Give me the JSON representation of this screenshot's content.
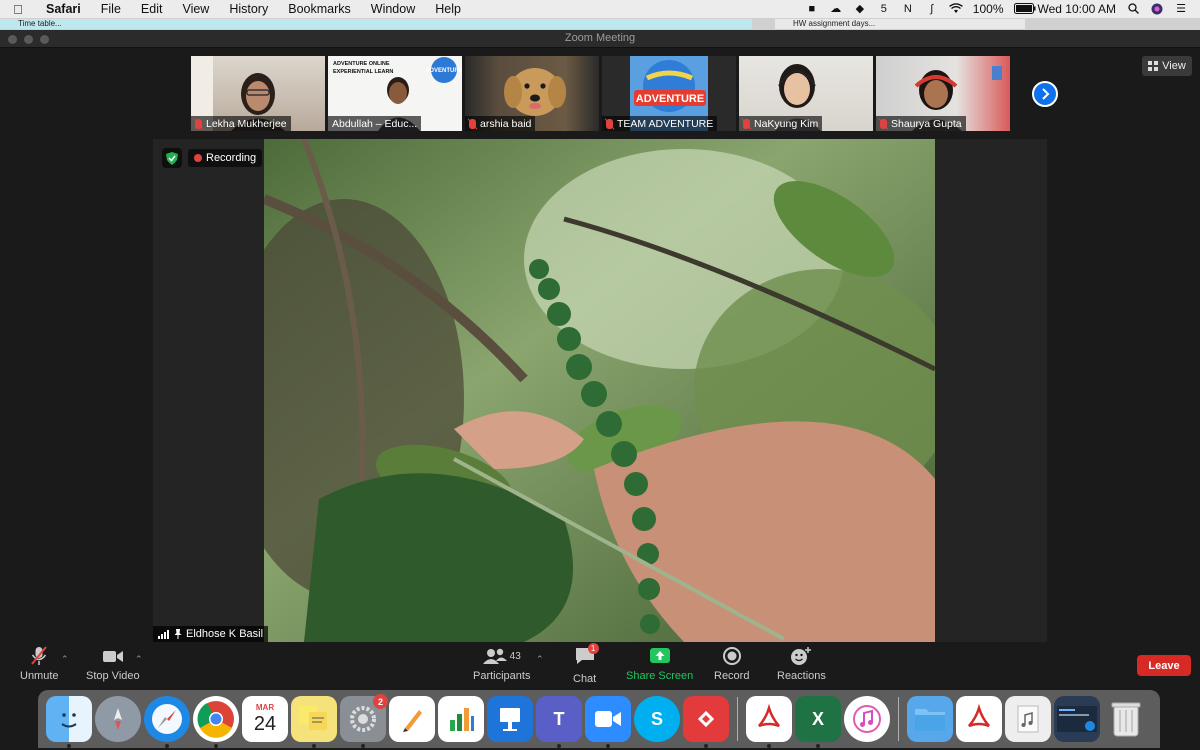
{
  "menubar": {
    "app_name": "Safari",
    "items": [
      "File",
      "Edit",
      "View",
      "History",
      "Bookmarks",
      "Window",
      "Help"
    ],
    "battery": "100%",
    "clock": "Wed 10:00 AM"
  },
  "tabs": {
    "tab1": "Time table...",
    "tab2": "HW assignment days..."
  },
  "window": {
    "title": "Zoom Meeting"
  },
  "participants_strip": [
    {
      "name": "Lekha Mukherjee"
    },
    {
      "name": "Abdullah – Educ..."
    },
    {
      "name": "arshia baid"
    },
    {
      "name": "TEAM ADVENTURE"
    },
    {
      "name": "NaKyung Kim"
    },
    {
      "name": "Shaurya Gupta"
    }
  ],
  "thumb_text": {
    "banner_line1": "ADVENTURE ONLINE",
    "banner_line2": "EXPERIENTIAL LEARN",
    "logo": "ADVENTURE"
  },
  "view_button": "View",
  "recording": {
    "label": "Recording"
  },
  "active_speaker": {
    "name": "Eldhose K Basil"
  },
  "controls": {
    "unmute": "Unmute",
    "stop_video": "Stop Video",
    "participants": "Participants",
    "participant_count": "43",
    "chat": "Chat",
    "chat_badge": "1",
    "share_screen": "Share Screen",
    "record": "Record",
    "reactions": "Reactions",
    "leave": "Leave"
  },
  "dock": {
    "calendar_month": "MAR",
    "calendar_day": "24",
    "prefs_badge": "2"
  },
  "colors": {
    "zoom_blue": "#0e72ed",
    "share_green": "#22c55e",
    "leave_red": "#d72a24",
    "recording_red": "#e0433f"
  }
}
